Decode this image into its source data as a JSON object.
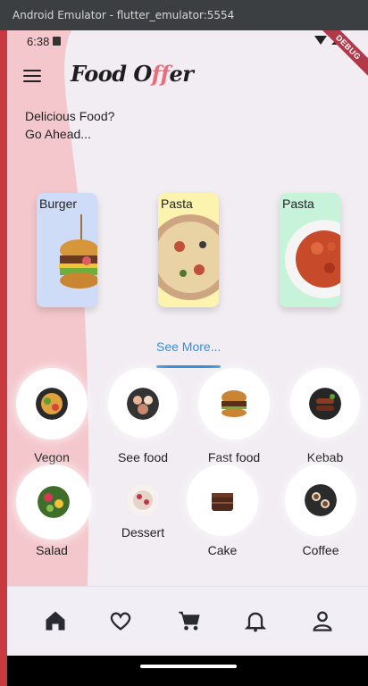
{
  "window": {
    "title": "Android Emulator - flutter_emulator:5554"
  },
  "status_bar": {
    "time": "6:38",
    "debug_label": "DEBUG"
  },
  "header": {
    "logo_part1": "Food O",
    "logo_part2": "ff",
    "logo_part3": "er"
  },
  "tagline": {
    "line1": "Delicious Food?",
    "line2": "Go Ahead..."
  },
  "featured": [
    {
      "label": "Burger",
      "bg": "#cfdcf8"
    },
    {
      "label": "Pasta",
      "bg": "#fbf3ae"
    },
    {
      "label": "Pasta",
      "bg": "#c6f3d9"
    }
  ],
  "see_more": {
    "label": "See More..."
  },
  "categories": [
    {
      "label": "Vegon",
      "icon": "salad-bowl-icon"
    },
    {
      "label": "See food",
      "icon": "seafood-platter-icon"
    },
    {
      "label": "Fast food",
      "icon": "burger-icon"
    },
    {
      "label": "Kebab",
      "icon": "kebab-plate-icon"
    },
    {
      "label": "Salad",
      "icon": "salad-icon"
    },
    {
      "label": "Dessert",
      "icon": "dessert-icon"
    },
    {
      "label": "Cake",
      "icon": "cake-icon"
    },
    {
      "label": "Coffee",
      "icon": "coffee-icon"
    }
  ],
  "bottom_nav": [
    {
      "icon": "home-icon",
      "active": true
    },
    {
      "icon": "heart-icon",
      "active": false
    },
    {
      "icon": "cart-icon",
      "active": false
    },
    {
      "icon": "bell-icon",
      "active": false
    },
    {
      "icon": "profile-icon",
      "active": false
    }
  ],
  "colors": {
    "accent": "#3a8ed6",
    "brand_pink": "#ee6b7a",
    "wave": "#f4c7cc",
    "frame_edge": "#c93a40"
  }
}
